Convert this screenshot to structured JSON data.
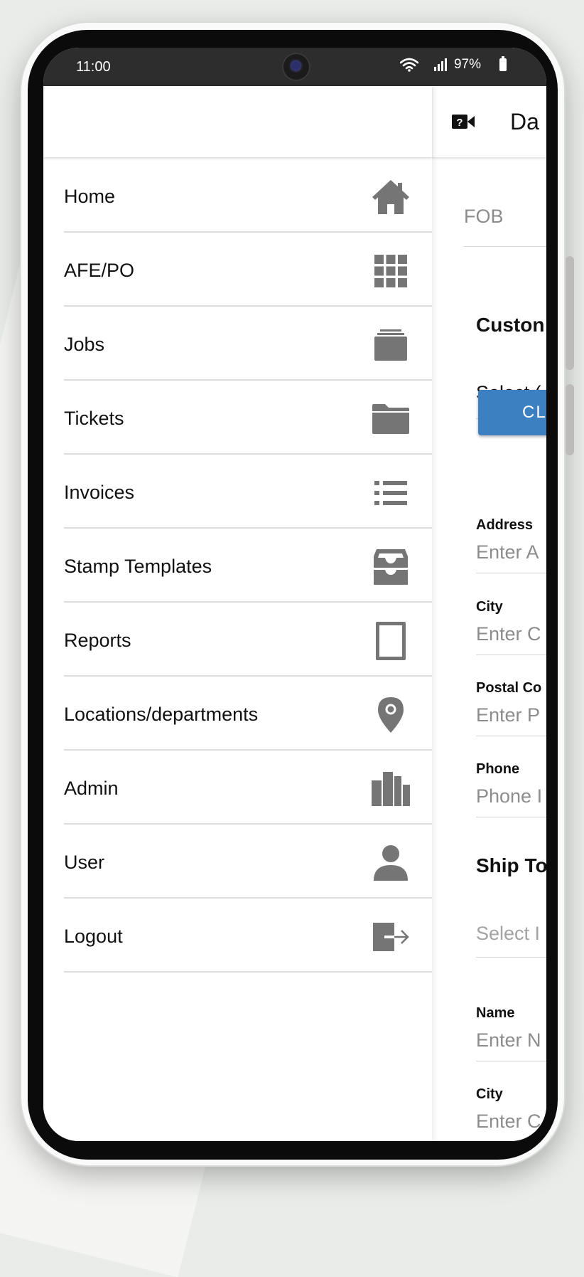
{
  "status_bar": {
    "time": "11:00",
    "battery": "97%",
    "icons": [
      "camera-punch-hole",
      "wifi-icon",
      "signal-icon",
      "battery-icon"
    ]
  },
  "drawer": {
    "items": [
      {
        "label": "Home",
        "icon": "home-icon"
      },
      {
        "label": "AFE/PO",
        "icon": "grid-icon"
      },
      {
        "label": "Jobs",
        "icon": "stack-icon"
      },
      {
        "label": "Tickets",
        "icon": "folder-icon"
      },
      {
        "label": "Invoices",
        "icon": "list-icon"
      },
      {
        "label": "Stamp Templates",
        "icon": "inbox-tray-icon"
      },
      {
        "label": "Reports",
        "icon": "tablet-icon"
      },
      {
        "label": "Locations/departments",
        "icon": "map-pin-icon"
      },
      {
        "label": "Admin",
        "icon": "bar-chart-icon"
      },
      {
        "label": "User",
        "icon": "user-icon"
      },
      {
        "label": "Logout",
        "icon": "logout-icon"
      }
    ],
    "icon_color": "#757575"
  },
  "background_page": {
    "header_title": "Da",
    "header_icon": "video-help-icon",
    "fob_value": "FOB",
    "customer_section": "Custon",
    "select_customer": "Select (",
    "clear_button": "CL",
    "address_label": "Address",
    "address_placeholder": "Enter A",
    "city_label": "City",
    "city_placeholder": "Enter C",
    "postal_label": "Postal Co",
    "postal_placeholder": "Enter P",
    "phone_label": "Phone",
    "phone_placeholder": "Phone I",
    "ship_section": "Ship To",
    "select_location": "Select I",
    "name_label": "Name",
    "name_placeholder": "Enter N",
    "ship_city_label": "City",
    "ship_city_placeholder": "Enter C",
    "accent_color": "#3d80c1"
  }
}
